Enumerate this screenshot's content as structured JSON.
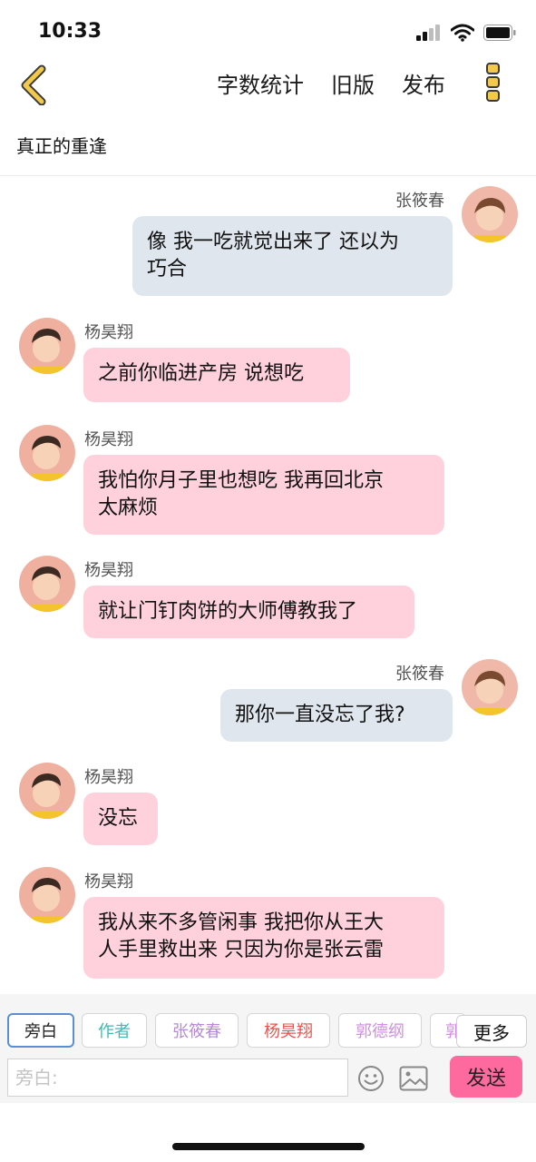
{
  "status_bar": {
    "time": "10:33"
  },
  "nav": {
    "actions": [
      "字数统计",
      "旧版",
      "发布"
    ]
  },
  "story": {
    "title": "真正的重逢"
  },
  "messages": [
    {
      "side": "right",
      "sender": "张筱春",
      "text": "像 我一吃就觉出来了 还以为\n巧合"
    },
    {
      "side": "left",
      "sender": "杨昊翔",
      "text": "之前你临进产房 说想吃"
    },
    {
      "side": "left",
      "sender": "杨昊翔",
      "text": "我怕你月子里也想吃 我再回北京\n太麻烦"
    },
    {
      "side": "left",
      "sender": "杨昊翔",
      "text": "就让门钉肉饼的大师傅教我了"
    },
    {
      "side": "right",
      "sender": "张筱春",
      "text": "那你一直没忘了我?"
    },
    {
      "side": "left",
      "sender": "杨昊翔",
      "text": "没忘"
    },
    {
      "side": "left",
      "sender": "杨昊翔",
      "text": "我从来不多管闲事 我把你从王大\n人手里救出来 只因为你是张云雷"
    }
  ],
  "roles": [
    {
      "label": "旁白",
      "color": "#222222"
    },
    {
      "label": "作者",
      "color": "#3fb9b4"
    },
    {
      "label": "张筱春",
      "color": "#b58ad6"
    },
    {
      "label": "杨昊翔",
      "color": "#e0574f"
    },
    {
      "label": "郭德纲",
      "color": "#d08ee0"
    },
    {
      "label": "郭",
      "color": "#d08ee0"
    }
  ],
  "more_label": "更多",
  "input": {
    "placeholder": "旁白:"
  },
  "send_label": "发送"
}
